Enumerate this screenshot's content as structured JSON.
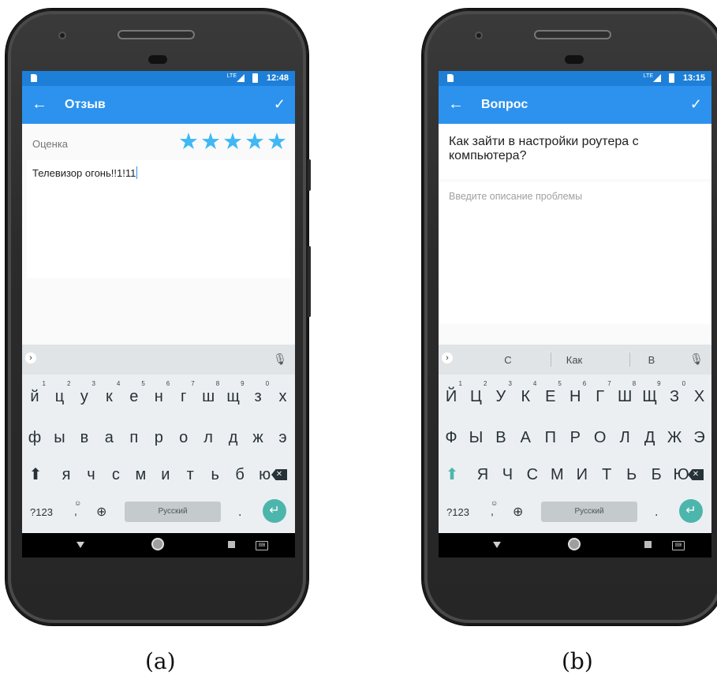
{
  "screen_a": {
    "status": {
      "lte": "LTE",
      "time": "12:48"
    },
    "appbar": {
      "back_icon": "arrow-left-icon",
      "title": "Отзыв",
      "confirm_icon": "check-icon"
    },
    "rating": {
      "label": "Оценка",
      "stars_filled": 5,
      "stars_total": 5,
      "star_color": "#3fb8f4"
    },
    "review_text": "Телевизор огонь!!1!11",
    "keyboard": {
      "suggestions": [],
      "row1": [
        "й",
        "ц",
        "у",
        "к",
        "е",
        "н",
        "г",
        "ш",
        "щ",
        "з",
        "х"
      ],
      "row1_hints": [
        "1",
        "2",
        "3",
        "4",
        "5",
        "6",
        "7",
        "8",
        "9",
        "0",
        ""
      ],
      "row2": [
        "ф",
        "ы",
        "в",
        "а",
        "п",
        "р",
        "о",
        "л",
        "д",
        "ж",
        "э"
      ],
      "row3": [
        "я",
        "ч",
        "с",
        "м",
        "и",
        "т",
        "ь",
        "б",
        "ю"
      ],
      "num_label": "?123",
      "emoji_label": ",",
      "space_label": "Русский",
      "period_label": "."
    },
    "caption": "(a)"
  },
  "screen_b": {
    "status": {
      "lte": "LTE",
      "time": "13:15"
    },
    "appbar": {
      "back_icon": "arrow-left-icon",
      "title": "Вопрос",
      "confirm_icon": "check-icon"
    },
    "question_text": "Как зайти в настройки роутера с компьютера?",
    "description_placeholder": "Введите описание проблемы",
    "keyboard": {
      "suggestions": [
        "С",
        "Как",
        "В"
      ],
      "row1": [
        "Й",
        "Ц",
        "У",
        "К",
        "Е",
        "Н",
        "Г",
        "Ш",
        "Щ",
        "З",
        "Х"
      ],
      "row1_hints": [
        "1",
        "2",
        "3",
        "4",
        "5",
        "6",
        "7",
        "8",
        "9",
        "0",
        ""
      ],
      "row2": [
        "Ф",
        "Ы",
        "В",
        "А",
        "П",
        "Р",
        "О",
        "Л",
        "Д",
        "Ж",
        "Э"
      ],
      "row3": [
        "Я",
        "Ч",
        "С",
        "М",
        "И",
        "Т",
        "Ь",
        "Б",
        "Ю"
      ],
      "num_label": "?123",
      "emoji_label": ",",
      "space_label": "Русский",
      "period_label": "."
    },
    "caption": "(b)"
  },
  "colors": {
    "status_bar": "#1e7fd8",
    "app_bar": "#2c92ee",
    "enter_key": "#4db6ac",
    "shift_active": "#4db6ac"
  }
}
